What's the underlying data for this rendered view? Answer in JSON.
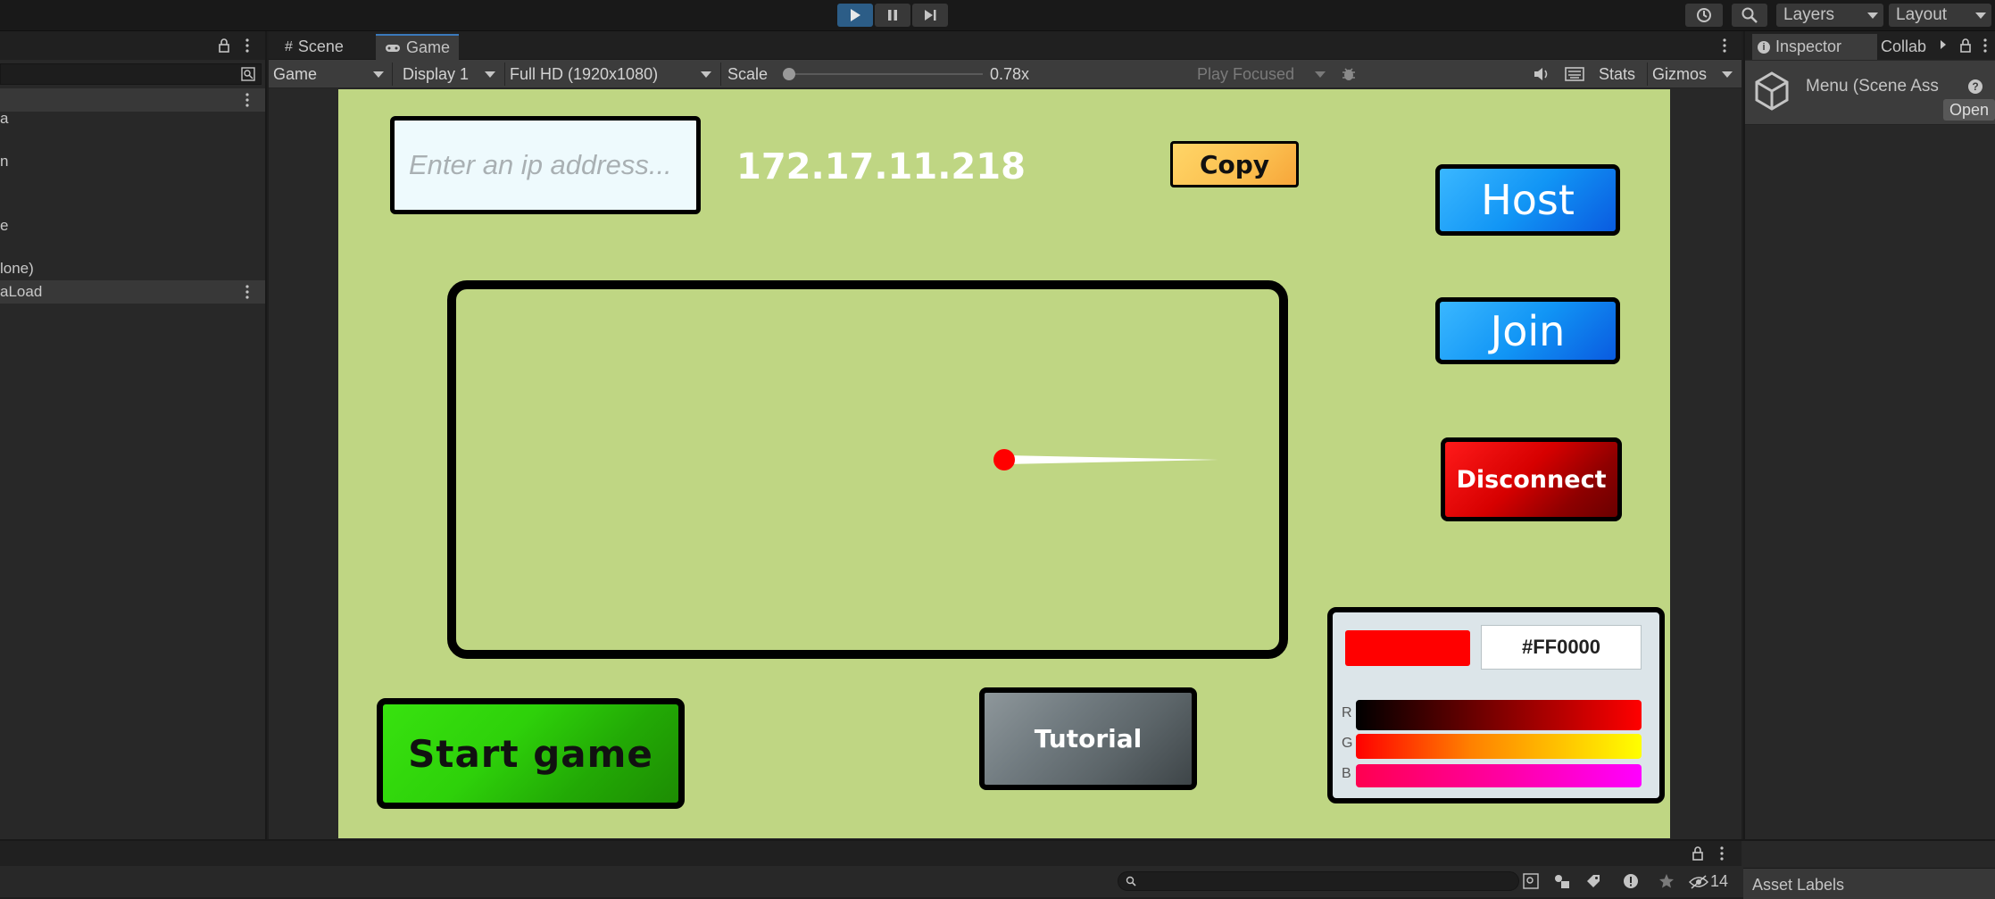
{
  "hierarchy": {
    "rows": [
      "a",
      "n",
      "e",
      "lone)",
      "aLoad"
    ]
  },
  "tabs": {
    "scene": "Scene",
    "game": "Game"
  },
  "game_toolbar": {
    "view": "Game",
    "display": "Display 1",
    "resolution": "Full HD (1920x1080)",
    "scale_label": "Scale",
    "scale_value": "0.78x",
    "play_mode": "Play Focused",
    "stats": "Stats",
    "gizmos": "Gizmos"
  },
  "top_right": {
    "layers": "Layers",
    "layout": "Layout"
  },
  "inspector": {
    "tab": "Inspector",
    "collab": "Collab",
    "title": "Menu (Scene Ass",
    "open": "Open",
    "asset_labels": "Asset Labels"
  },
  "game": {
    "ip_placeholder": "Enter an ip address...",
    "ip_value": "",
    "ip_address": "172.17.11.218",
    "copy": "Copy",
    "host": "Host",
    "join": "Join",
    "disconnect": "Disconnect",
    "start_game": "Start game",
    "tutorial": "Tutorial",
    "color_picker": {
      "hex": "#FF0000",
      "r_label": "R",
      "g_label": "G",
      "b_label": "B",
      "r": 1.0,
      "g": 0.0,
      "b": 0.0,
      "swatch": "#ff0000"
    }
  },
  "console": {
    "hidden_count": "14"
  },
  "colors": {
    "accent": "#2c5d87",
    "viewport_bg": "#bfd683",
    "player": "#ff0000"
  }
}
